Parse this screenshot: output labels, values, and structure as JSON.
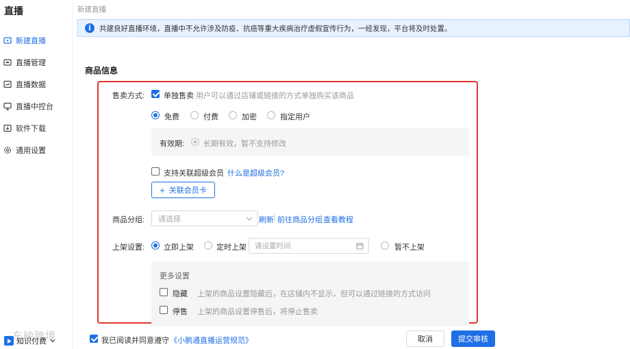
{
  "sidebar": {
    "title": "直播",
    "items": [
      {
        "label": "新建直播",
        "icon": "new-live-icon",
        "active": true
      },
      {
        "label": "直播管理",
        "icon": "live-manage-icon"
      },
      {
        "label": "直播数据",
        "icon": "live-data-icon"
      },
      {
        "label": "直播中控台",
        "icon": "console-icon"
      },
      {
        "label": "软件下载",
        "icon": "download-icon"
      },
      {
        "label": "通用设置",
        "icon": "gear-icon"
      }
    ],
    "footer_label": "知识付费",
    "watermark": "东映跨境"
  },
  "breadcrumb": "新建直播",
  "notice": "共建良好直播环境，直播中不允许涉及防疫、抗癌等重大疾病治疗虚假宣传行为，一经发现，平台将及时处置。",
  "section_title": "商品信息",
  "sale": {
    "label": "售卖方式:",
    "single_label": "单独售卖",
    "single_hint": "用户可以通过店铺或链接的方式单独购买该商品",
    "options": [
      "免费",
      "付费",
      "加密",
      "指定用户"
    ],
    "selected": "免费",
    "validity_label": "有效期:",
    "validity_value": "长期有效，暂不支持修改",
    "super_member_label": "支持关联超级会员",
    "super_member_link": "什么是超级会员?",
    "link_card_button": "关联会员卡"
  },
  "group": {
    "label": "商品分组:",
    "placeholder": "请选择",
    "refresh": "刷新",
    "goto": "前往商品分组",
    "tutorial": "查看教程"
  },
  "shelf": {
    "label": "上架设置:",
    "options": [
      "立即上架",
      "定时上架",
      "暂不上架"
    ],
    "selected": "立即上架",
    "time_placeholder": "请设置时间",
    "more_title": "更多设置",
    "hide_label": "隐藏",
    "hide_hint": "上架的商品设置隐藏后，在店铺内不显示，但可以通过链接的方式访问",
    "stop_label": "停售",
    "stop_hint": "上架的商品设置停售后，将停止售卖"
  },
  "footer": {
    "agree_text": "我已阅读并同意遵守",
    "agree_link": "《小鹅通直播运营规范》",
    "cancel": "取消",
    "submit": "提交审核"
  },
  "colors": {
    "accent": "#1f6fe5",
    "highlight_border": "#e0332f"
  }
}
